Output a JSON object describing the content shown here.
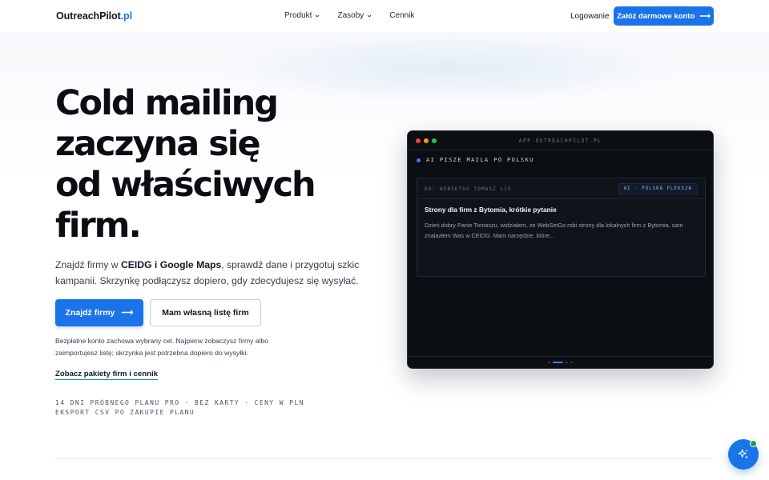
{
  "nav": {
    "logo_main": "OutreachPilot",
    "logo_accent": ".pl",
    "links": [
      {
        "label": "Produkt"
      },
      {
        "label": "Zasoby"
      },
      {
        "label": "Cennik"
      }
    ],
    "login_label": "Logowanie",
    "cta_label": "Załóż darmowe konto",
    "cta_arrow": "⟶"
  },
  "hero": {
    "title_line1": "Cold mailing",
    "title_line2": "zaczyna się",
    "title_line3": "od właściwych",
    "title_line4": "firm.",
    "desc_part1": "Znajdź firmy w ",
    "desc_bold": "CEIDG i Google Maps",
    "desc_part2": ", sprawdź dane i przygotuj szkic kampanii. Skrzynkę podłączysz dopiero, gdy zdecydujesz się wysyłać.",
    "primary_button": "Znajdź firmy",
    "primary_arrow": "⟶",
    "secondary_button": "Mam własną listę firm",
    "note": "Bezpłatne konto zachowa wybrany cel. Najpierw zobaczysz firmy albo zaimportujesz listę; skrzynka jest potrzebna dopiero do wysyłki.",
    "pricing_link": "Zobacz pakiety firm i cennik",
    "mono_line1": "14 DNI PRÓBNEGO PLANU PRO · BEZ KARTY · CENY W PLN",
    "mono_line2": "EKSPORT CSV PO ZAKUPIE PLANU"
  },
  "window": {
    "url": "APP.OUTREACHPILOT.PL",
    "dot_colors": [
      "#ef4444",
      "#f59e0b",
      "#22c55e"
    ],
    "status_text": "AI PISZE MAILA PO POLSKU",
    "mail_to": "DO: WEBSETGO TOMASZ LIS",
    "mail_tag": "AI · POLSKA FLEKSJA",
    "mail_subject": "Strony dla firm z Bytomia, krótkie pytanie",
    "mail_body": "Dzień dobry Panie Tomaszu, widziałem, że WebSetGo robi strony dla lokalnych firm z Bytomia, sam znalazłem Was w CEIDG. Mam narzędzie, które..."
  },
  "colors": {
    "accent": "#1a73e8",
    "link_underline": "#0f9d7a",
    "badge": "#16a34a"
  },
  "icons": {
    "fab": "sparkles-icon"
  }
}
